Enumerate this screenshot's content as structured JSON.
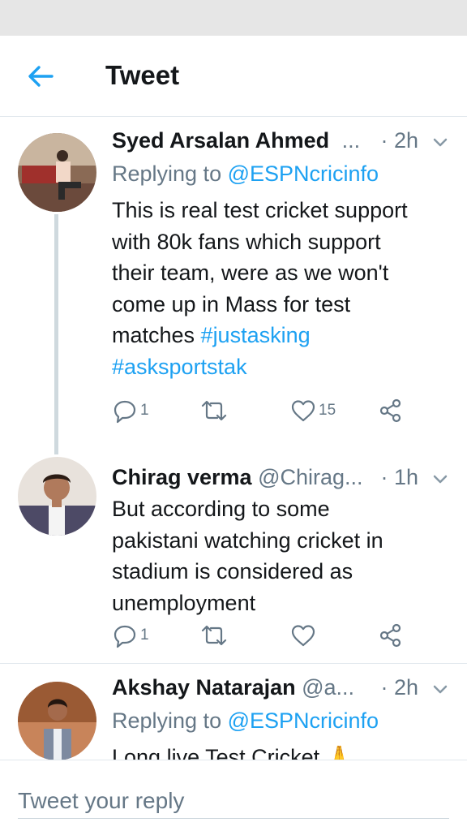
{
  "header": {
    "title": "Tweet",
    "back_icon": "arrow-left-icon",
    "accent": "#1da1f2"
  },
  "tweets": [
    {
      "name": "Syed Arsalan Ahmed",
      "handle": "...",
      "time": "· 2h",
      "reply_prefix": "Replying to ",
      "reply_handle": "@ESPNcricinfo",
      "body_lines": [
        "This is real test cricket support",
        "with 80k fans which  support",
        "their team, were as we won't",
        "come up in Mass for test"
      ],
      "body_last_prefix": "matches ",
      "hashtag_1": "#justasking",
      "hashtag_2": "#asksportstak",
      "reply_count": "1",
      "retweet_count": "",
      "like_count": "15"
    },
    {
      "name": "Chirag verma",
      "handle": " @Chirag...",
      "time": "· 1h",
      "body_lines": [
        "But according to some",
        "pakistani watching cricket in",
        "stadium is considered as",
        "unemployment"
      ],
      "reply_count": "1",
      "retweet_count": "",
      "like_count": ""
    },
    {
      "name": "Akshay Natarajan",
      "handle": " @a...",
      "time": "· 2h",
      "reply_prefix": "Replying to ",
      "reply_handle": "@ESPNcricinfo",
      "body_lines": [
        "Long live Test Cricket 🙏"
      ]
    }
  ],
  "reply_box": {
    "placeholder": "Tweet your reply"
  }
}
